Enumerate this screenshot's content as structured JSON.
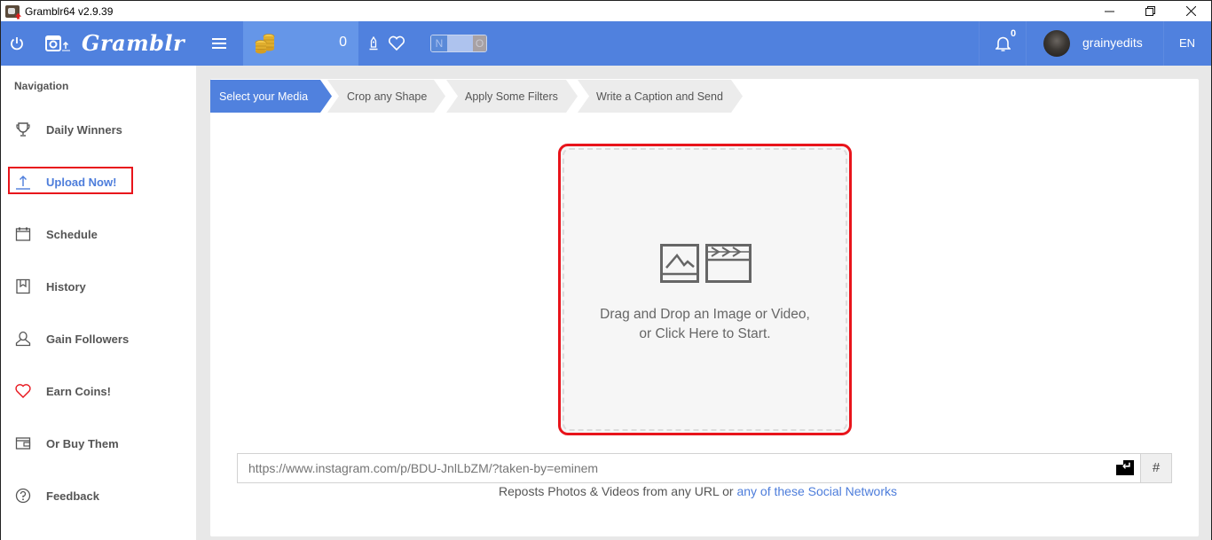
{
  "window": {
    "title": "Gramblr64 v2.9.39",
    "controls": {
      "minimize": "minimize-icon",
      "restore": "restore-icon",
      "close": "close-icon"
    }
  },
  "header": {
    "logo_text": "Gramblr",
    "coins_count": "0",
    "toggle": {
      "left_label": "N",
      "right_label": "O"
    },
    "notifications_count": "0",
    "username": "grainyedits",
    "language": "EN",
    "colors": {
      "bar": "#5081de",
      "coins_bg": "#6596e8"
    }
  },
  "sidebar": {
    "title": "Navigation",
    "items": [
      {
        "label": "Daily Winners",
        "icon": "trophy-icon",
        "active": false
      },
      {
        "label": "Upload Now!",
        "icon": "upload-icon",
        "active": true
      },
      {
        "label": "Schedule",
        "icon": "calendar-icon",
        "active": false
      },
      {
        "label": "History",
        "icon": "bookmark-icon",
        "active": false
      },
      {
        "label": "Gain Followers",
        "icon": "user-icon",
        "active": false
      },
      {
        "label": "Earn Coins!",
        "icon": "heart-icon",
        "active": false
      },
      {
        "label": "Or Buy Them",
        "icon": "wallet-icon",
        "active": false
      },
      {
        "label": "Feedback",
        "icon": "question-icon",
        "active": false
      }
    ]
  },
  "steps": [
    {
      "label": "Select your Media",
      "active": true
    },
    {
      "label": "Crop any Shape",
      "active": false
    },
    {
      "label": "Apply Some Filters",
      "active": false
    },
    {
      "label": "Write a Caption and Send",
      "active": false
    }
  ],
  "dropzone": {
    "line1": "Drag and Drop an Image or Video,",
    "line2": "or Click Here to Start."
  },
  "url_input": {
    "value": "",
    "placeholder": "https://www.instagram.com/p/BDU-JnlLbZM/?taken-by=eminem"
  },
  "hash_button": "#",
  "hint": {
    "text": "Reposts Photos & Videos from any URL or ",
    "link": "any of these Social Networks"
  },
  "accent_color": "#4d7ddb",
  "highlight_color": "#e8141b"
}
